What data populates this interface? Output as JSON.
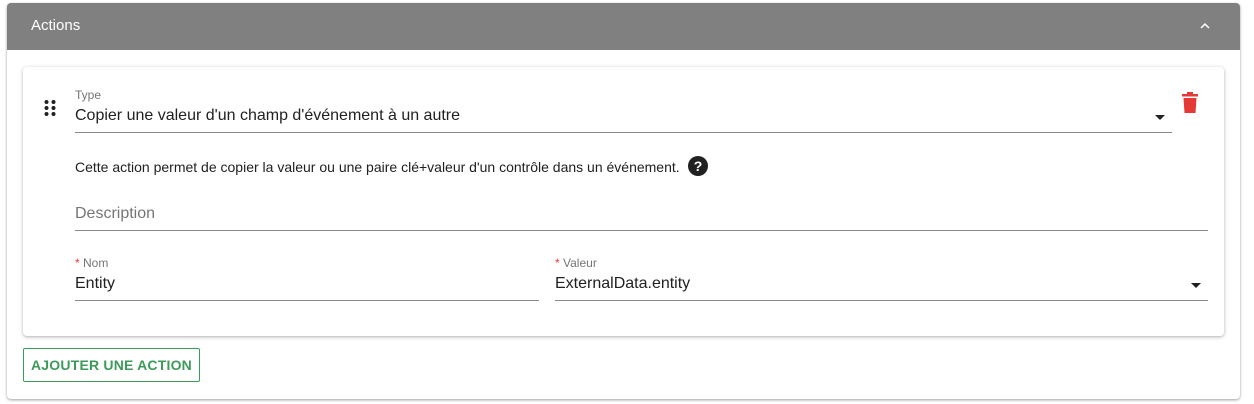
{
  "panel": {
    "title": "Actions",
    "collapse_icon": "chevron-up-icon",
    "header_color": "#808080"
  },
  "action": {
    "drag_icon": "drag-handle-icon",
    "type": {
      "label": "Type",
      "value": "Copier une valeur d'un champ d'événement à un autre"
    },
    "delete_icon": "trash-icon",
    "delete_color": "#e53935",
    "help_text": "Cette action permet de copier la valeur ou une paire clé+valeur d'un contrôle dans un événement.",
    "help_icon": "question-circle-icon",
    "description": {
      "placeholder": "Description",
      "value": ""
    },
    "nom": {
      "required_mark": "*",
      "label": "Nom",
      "value": "Entity"
    },
    "valeur": {
      "required_mark": "*",
      "label": "Valeur",
      "value": "ExternalData.entity"
    }
  },
  "add_action_button": {
    "label": "AJOUTER UNE ACTION",
    "color": "#3c9b5a"
  }
}
